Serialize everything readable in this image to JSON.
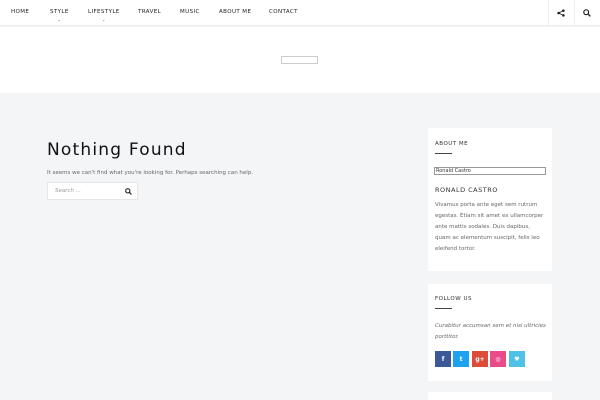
{
  "nav": {
    "items": [
      {
        "label": "HOME",
        "has_caret": false
      },
      {
        "label": "STYLE",
        "has_caret": true
      },
      {
        "label": "LIFESTYLE",
        "has_caret": true
      },
      {
        "label": "TRAVEL",
        "has_caret": false
      },
      {
        "label": "MUSIC",
        "has_caret": false
      },
      {
        "label": "ABOUT ME",
        "has_caret": false
      },
      {
        "label": "CONTACT",
        "has_caret": false
      }
    ],
    "caret_glyph": "⌄",
    "share_icon": "share-icon",
    "search_icon": "search-icon"
  },
  "main": {
    "title": "Nothing Found",
    "description": "It seems we can't find what you're looking for. Perhaps searching can help.",
    "search": {
      "placeholder": "Search ..."
    }
  },
  "sidebar": {
    "about": {
      "title": "ABOUT ME",
      "image_alt": "Ronald Castro",
      "name": "RONALD CASTRO",
      "text": "Vivamus porta ante eget sem rutrum egestas. Etiam sit amet ex ullamcorper ante mattis sodales. Duis dapibus, quam ac elementum suscipit, felis leo eleifend tortor."
    },
    "follow": {
      "title": "FOLLOW US",
      "text": "Curabitur accumsan sem et nisi ultricies porttitor.",
      "socials": [
        {
          "name": "facebook-icon",
          "glyph": "f",
          "color": "#3b5998"
        },
        {
          "name": "twitter-icon",
          "glyph": "t",
          "color": "#1da1f2"
        },
        {
          "name": "google-plus-icon",
          "glyph": "g+",
          "color": "#dd4b39"
        },
        {
          "name": "dribbble-icon",
          "glyph": "◎",
          "color": "#ea4c89"
        },
        {
          "name": "bloglovin-icon",
          "glyph": "♥",
          "color": "#4fc1e9"
        }
      ]
    }
  },
  "colors": {
    "page_bg": "#f4f5f7",
    "panel_bg": "#ffffff"
  }
}
